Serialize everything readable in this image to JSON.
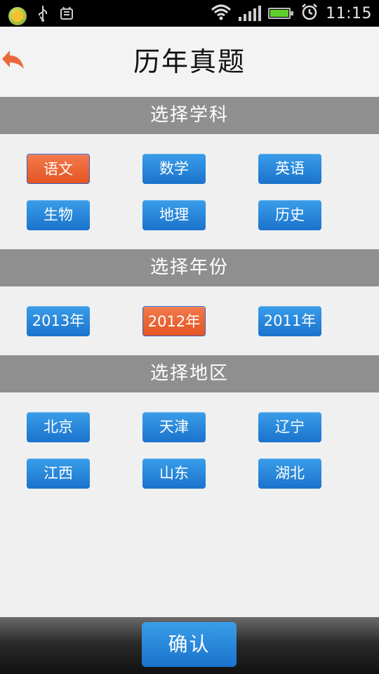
{
  "status_bar": {
    "time": "11:15",
    "icons": [
      "app-plus-icon",
      "usb-icon",
      "android-debug-icon",
      "wifi-icon",
      "signal-icon",
      "battery-icon",
      "alarm-icon"
    ],
    "battery_level": 1.0
  },
  "header": {
    "title": "历年真题",
    "back_icon": "back-arrow-icon",
    "back_color": "#e9693b"
  },
  "sections": {
    "subject": {
      "title": "选择学科",
      "options": [
        "语文",
        "数学",
        "英语",
        "生物",
        "地理",
        "历史"
      ],
      "selected": "语文"
    },
    "year": {
      "title": "选择年份",
      "options": [
        "2013年",
        "2012年",
        "2011年"
      ],
      "selected": "2012年"
    },
    "region": {
      "title": "选择地区",
      "options": [
        "北京",
        "天津",
        "辽宁",
        "江西",
        "山东",
        "湖北"
      ]
    }
  },
  "footer": {
    "confirm_label": "确认"
  },
  "colors": {
    "button_blue": "#2a86dc",
    "button_selected": "#ea6433",
    "section_header": "#8f8f8f"
  }
}
